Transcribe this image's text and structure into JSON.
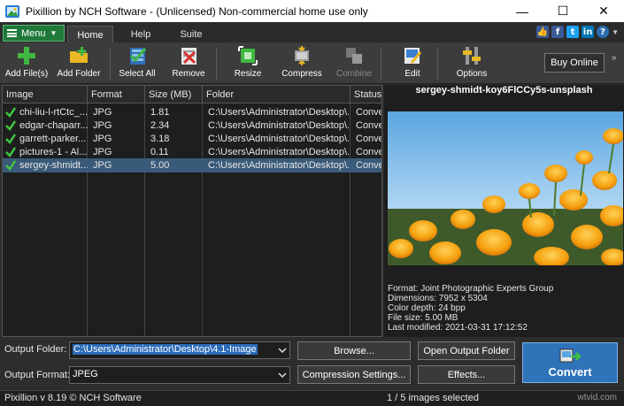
{
  "window": {
    "title": "Pixillion by NCH Software - (Unlicensed) Non-commercial home use only",
    "minimize": "—",
    "maximize": "☐",
    "close": "✕"
  },
  "ribbon": {
    "menu_label": "Menu",
    "tabs": [
      "Home",
      "Help",
      "Suite"
    ],
    "active_tab": "Home",
    "help_icon_label": "?"
  },
  "toolbar": {
    "buttons": [
      {
        "label": "Add File(s)",
        "icon": "add-files-icon"
      },
      {
        "label": "Add Folder",
        "icon": "add-folder-icon"
      },
      {
        "label": "Select All",
        "icon": "select-all-icon"
      },
      {
        "label": "Remove",
        "icon": "remove-icon"
      },
      {
        "label": "Resize",
        "icon": "resize-icon"
      },
      {
        "label": "Compress",
        "icon": "compress-icon"
      },
      {
        "label": "Combine",
        "icon": "combine-icon",
        "disabled": true
      },
      {
        "label": "Edit",
        "icon": "edit-icon"
      },
      {
        "label": "Options",
        "icon": "options-icon"
      }
    ],
    "buy_online": "Buy Online",
    "more": "»"
  },
  "file_list": {
    "columns": [
      "Image",
      "Format",
      "Size (MB)",
      "Folder",
      "Status"
    ],
    "rows": [
      {
        "image": "chi-liu-l-rtCtc_...",
        "format": "JPG",
        "size": "1.81",
        "folder": "C:\\Users\\Administrator\\Desktop\\...",
        "status": "Convert"
      },
      {
        "image": "edgar-chaparr...",
        "format": "JPG",
        "size": "2.34",
        "folder": "C:\\Users\\Administrator\\Desktop\\...",
        "status": "Convert"
      },
      {
        "image": "garrett-parker...",
        "format": "JPG",
        "size": "3.18",
        "folder": "C:\\Users\\Administrator\\Desktop\\...",
        "status": "Convert"
      },
      {
        "image": "pictures-1 - Al...",
        "format": "JPG",
        "size": "0.11",
        "folder": "C:\\Users\\Administrator\\Desktop\\...",
        "status": "Convert"
      },
      {
        "image": "sergey-shmidt...",
        "format": "JPG",
        "size": "5.00",
        "folder": "C:\\Users\\Administrator\\Desktop\\...",
        "status": "Convert",
        "selected": true
      }
    ]
  },
  "preview": {
    "title": "sergey-shmidt-koy6FlCCy5s-unsplash",
    "info": [
      "Format: Joint Photographic Experts Group",
      "Dimensions: 7952 x 5304",
      "Color depth: 24 bpp",
      "File size: 5.00 MB",
      "Last modified:  2021-03-31 17:12:52"
    ]
  },
  "output": {
    "folder_label": "Output Folder:",
    "folder_value": "C:\\Users\\Administrator\\Desktop\\4.1-Image",
    "format_label": "Output Format:",
    "format_value": "JPEG",
    "browse": "Browse...",
    "open_output_folder": "Open Output Folder",
    "compression_settings": "Compression Settings...",
    "effects": "Effects...",
    "convert": "Convert"
  },
  "status": {
    "version": "Pixillion v 8.19 © NCH Software",
    "selection": "1 / 5 images selected",
    "watermark": "wtvid.com"
  },
  "colors": {
    "menu_green": "#1f7a3a",
    "convert_blue": "#2f73b8",
    "selected_row": "#3a5a7a"
  }
}
